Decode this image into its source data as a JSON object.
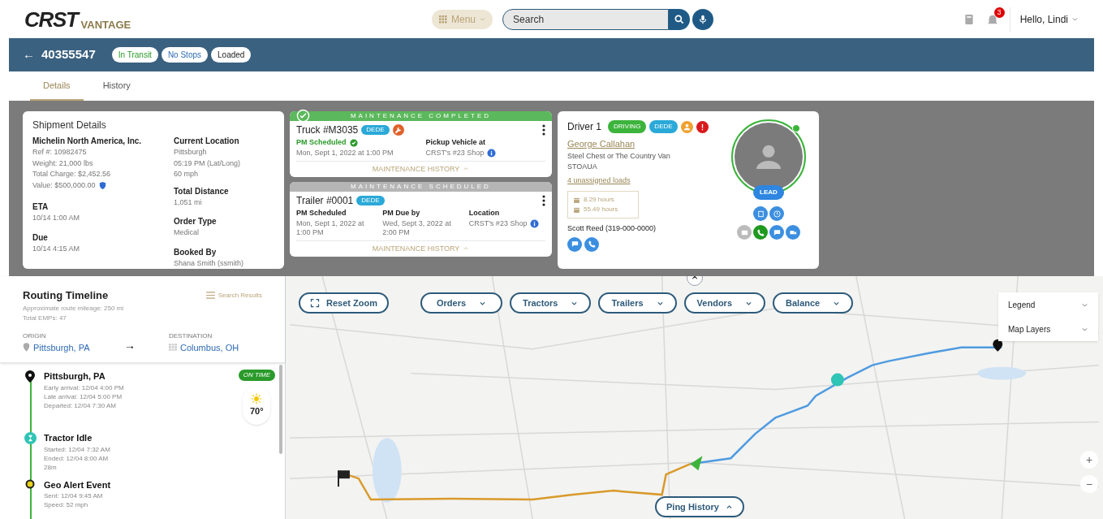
{
  "header": {
    "logo_main": "CRST",
    "logo_sub": "VANTAGE",
    "menu": "Menu",
    "search": {
      "placeholder": "Search"
    },
    "notifications": "3",
    "greeting": "Hello, Lindi"
  },
  "load_bar": {
    "back": "←",
    "load_number": "40355547",
    "badges": [
      {
        "label": "In Transit",
        "kind": "transit"
      },
      {
        "label": "No Stops",
        "kind": "stops"
      },
      {
        "label": "Loaded",
        "kind": "plain"
      }
    ]
  },
  "tabs": [
    {
      "label": "Details",
      "selected": true
    },
    {
      "label": "History",
      "selected": false
    }
  ],
  "shipment": {
    "title": "Shipment Details",
    "left": [
      {
        "kind": "name",
        "text": "Michelin North America, Inc."
      },
      {
        "kind": "line",
        "text": "Ref #: 10982475"
      },
      {
        "kind": "line",
        "text": "Weight: 21,000 lbs"
      },
      {
        "kind": "line",
        "text": "Total Charge: $2,452.56"
      },
      {
        "kind": "value",
        "text": "Value: $500,000.00"
      }
    ],
    "fields_left": [
      {
        "label": "ETA",
        "value": "10/14 1:00 AM"
      },
      {
        "label": "Due",
        "value": "10/14 4:15 AM"
      }
    ],
    "current_location": {
      "label": "Current Location",
      "lines": [
        "Pittsburgh",
        "05:19 PM (Lat/Long)",
        "60 mph"
      ]
    },
    "fields_right": [
      {
        "label": "Total Distance",
        "value": "1,051 mi"
      },
      {
        "label": "Order Type",
        "value": "Medical"
      },
      {
        "label": "Booked By",
        "value": "Shana Smith (ssmith)"
      }
    ]
  },
  "maintenance": [
    {
      "banner": "MAINTENANCE COMPLETED",
      "completed": true,
      "unit": "Truck #M3035",
      "badge": "DEDE",
      "wrench": true,
      "columns": [
        {
          "label": "PM Scheduled",
          "ok": true,
          "value": "Mon, Sept 1, 2022 at 1:00 PM",
          "info": false
        },
        {
          "label": "Pickup Vehicle at",
          "ok": false,
          "value": "CRST's #23 Shop",
          "info": true
        }
      ],
      "history": "MAINTENANCE HISTORY"
    },
    {
      "banner": "MAINTENANCE SCHEDULED",
      "completed": false,
      "unit": "Trailer #0001",
      "badge": "DEDE",
      "wrench": false,
      "columns": [
        {
          "label": "PM Scheduled",
          "ok": false,
          "value": "Mon, Sept 1, 2022 at 1:00 PM",
          "info": false
        },
        {
          "label": "PM Due by",
          "ok": false,
          "value": "Wed, Sept 3, 2022 at 2:00 PM",
          "info": false
        },
        {
          "label": "Location",
          "ok": false,
          "value": "CRST's #23 Shop",
          "info": true
        }
      ],
      "history": "MAINTENANCE HISTORY"
    }
  ],
  "driver": {
    "title": "Driver 1",
    "status": "DRIVING",
    "badge": "DEDE",
    "name": "George Callahan",
    "fleet": "Steel Chest or The Country Van",
    "code": "STOAUA",
    "loads_link": "4 unassigned loads",
    "hours": [
      "8.29 hours",
      "55.49 hours"
    ],
    "manager": "Scott Reed (319-000-0000)",
    "online": true,
    "role": "LEAD"
  },
  "routing": {
    "title": "Routing Timeline",
    "mileage": "Approximate route mileage: 250 mi",
    "total": "Total EMPs: 47",
    "search_results": "Search Results",
    "origin_label": "ORIGIN",
    "origin": "Pittsburgh, PA",
    "arrow": "→",
    "destination_label": "DESTINATION",
    "destination": "Columbus, OH",
    "events": [
      {
        "kind": "stop",
        "title": "Pittsburgh, PA",
        "lines": [
          "Early arrival: 12/04 4:00 PM",
          "Late arrival: 12/04 5:00 PM",
          "Departed: 12/04 7:30 AM"
        ],
        "status": "ON TIME",
        "temp": "70°"
      },
      {
        "kind": "idle",
        "title": "Tractor Idle",
        "lines": [
          "Started: 12/04 7:32 AM",
          "Ended: 12/04 8:00 AM",
          "28m"
        ]
      },
      {
        "kind": "geo",
        "title": "Geo Alert Event",
        "lines": [
          "Sent: 12/04 9:45 AM",
          "Speed: 52 mph"
        ]
      }
    ]
  },
  "map": {
    "reset": "Reset Zoom",
    "filters": [
      "Orders",
      "Tractors",
      "Trailers",
      "Vendors",
      "Balance"
    ],
    "panels": [
      "Legend",
      "Map Layers"
    ],
    "ping_history": "Ping History",
    "zoom_in": "+",
    "zoom_out": "−"
  }
}
